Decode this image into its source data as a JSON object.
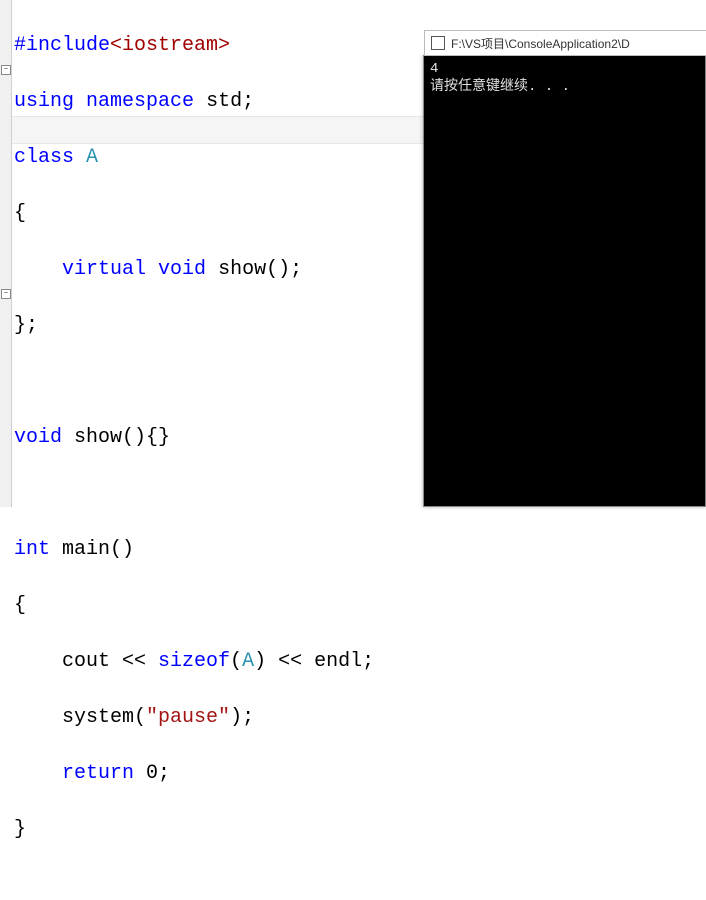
{
  "code": {
    "line1": {
      "pp": "#include",
      "angle_open": "<",
      "header": "iostream",
      "angle_close": ">"
    },
    "line2": {
      "kw1": "using",
      "kw2": "namespace",
      "ns": "std",
      "semi": ";"
    },
    "line3": {
      "kw": "class",
      "name": "A"
    },
    "line4": "{",
    "line5": {
      "indent": "    ",
      "kw1": "virtual",
      "kw2": "void",
      "fn": "show",
      "parens": "();"
    },
    "line6": "};",
    "line8": {
      "kw": "void",
      "fn": "show",
      "rest": "(){}"
    },
    "line10": {
      "kw": "int",
      "fn": "main",
      "rest": "()"
    },
    "line11": "{",
    "line12": {
      "indent": "    ",
      "p1": "cout << ",
      "kw": "sizeof",
      "p2": "(",
      "arg": "A",
      "p3": ") << endl;"
    },
    "line13": {
      "indent": "    ",
      "fn": "system",
      "p1": "(",
      "str": "\"pause\"",
      "p2": ");"
    },
    "line14": {
      "indent": "    ",
      "kw": "return",
      "val": " 0;"
    },
    "line15": "}"
  },
  "console": {
    "title": "F:\\VS项目\\ConsoleApplication2\\D",
    "output_line1": "4",
    "output_line2": "请按任意键继续. . ."
  },
  "fold": {
    "minus": "−"
  }
}
